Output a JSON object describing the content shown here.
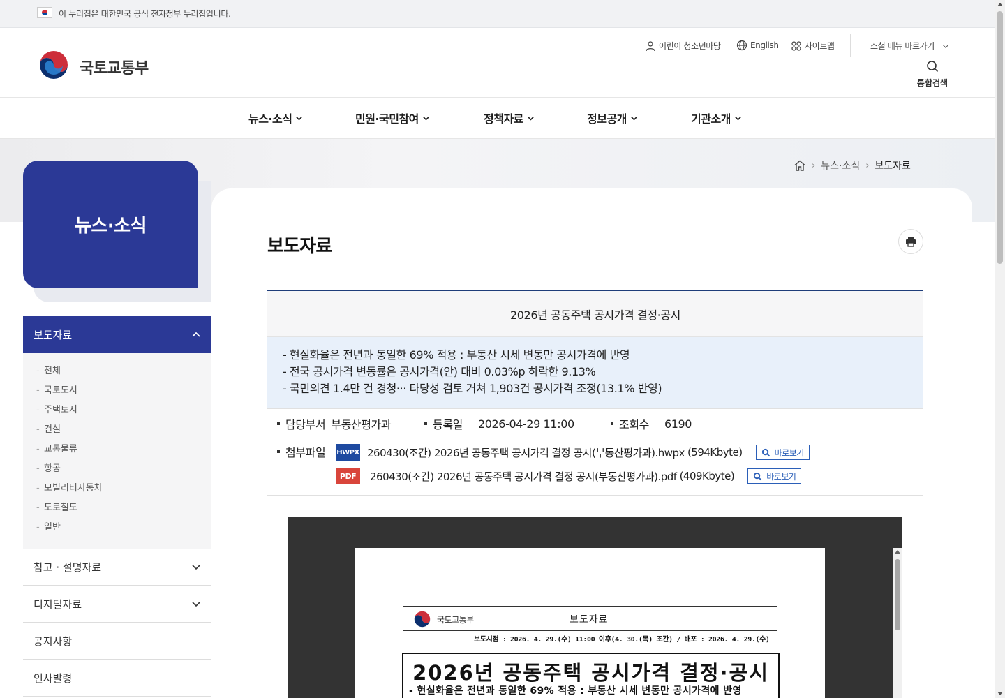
{
  "gov_banner": {
    "text": "이 누리집은 대한민국 공식 전자정부 누리집입니다."
  },
  "header": {
    "logo_text": "국토교통부",
    "util_links": {
      "kids": "어린이 청소년마당",
      "english": "English",
      "sitemap": "사이트맵"
    },
    "social_menu": "소셜 메뉴 바로가기",
    "search_label": "통합검색"
  },
  "gnb": [
    "뉴스·소식",
    "민원·국민참여",
    "정책자료",
    "정보공개",
    "기관소개"
  ],
  "side": {
    "title": "뉴스·소식",
    "active": "보도자료",
    "sub_items": [
      "전체",
      "국토도시",
      "주택토지",
      "건설",
      "교통물류",
      "항공",
      "모빌리티자동차",
      "도로철도",
      "일반"
    ],
    "items": [
      "참고 · 설명자료",
      "디지털자료",
      "공지사항",
      "인사발령"
    ]
  },
  "breadcrumb": {
    "level1": "뉴스·소식",
    "current": "보도자료"
  },
  "page_title": "보도자료",
  "article": {
    "title": "2026년 공동주택 공시가격 결정·공시",
    "summary": [
      "- 현실화율은 전년과 동일한 69% 적용 : 부동산 시세 변동만 공시가격에 반영",
      "- 전국 공시가격 변동률은 공시가격(안) 대비 0.03%p 하락한 9.13%",
      "- 국민의견 1.4만 건 경청··· 타당성 검토 거쳐 1,903건 공시가격 조정(13.1% 반영)"
    ],
    "dept_label": "담당부서",
    "dept": "부동산평가과",
    "date_label": "등록일",
    "date": "2026-04-29 11:00",
    "views_label": "조회수",
    "views": "6190",
    "attach_label": "첨부파일",
    "files": [
      {
        "type": "HWPX",
        "name": "260430(조간) 2026년 공동주택 공시가격 결정 공시(부동산평가과).hwpx",
        "size": "(594Kbyte)",
        "view": "바로보기"
      },
      {
        "type": "PDF",
        "name": "260430(조간) 2026년 공동주택 공시가격 결정 공시(부동산평가과).pdf",
        "size": "(409Kbyte)",
        "view": "바로보기"
      }
    ]
  },
  "doc_preview": {
    "org": "국토교통부",
    "kind": "보도자료",
    "release": "보도시점 : 2026. 4. 29.(수) 11:00 이후(4. 30.(목) 조간) / 배포 : 2026. 4. 29.(수)",
    "title": "2026년 공동주택 공시가격 결정·공시",
    "subtitle": "- 현실화율은 전년과 동일한 69% 적용 : 부동산 시세 변동만 공시가격에 반영"
  },
  "colors": {
    "primary": "#2b3996",
    "accent_line": "#1e3d7a",
    "summary_bg": "#e8f0fa",
    "hwpx": "#1e4aa0",
    "pdf": "#d9453b"
  }
}
